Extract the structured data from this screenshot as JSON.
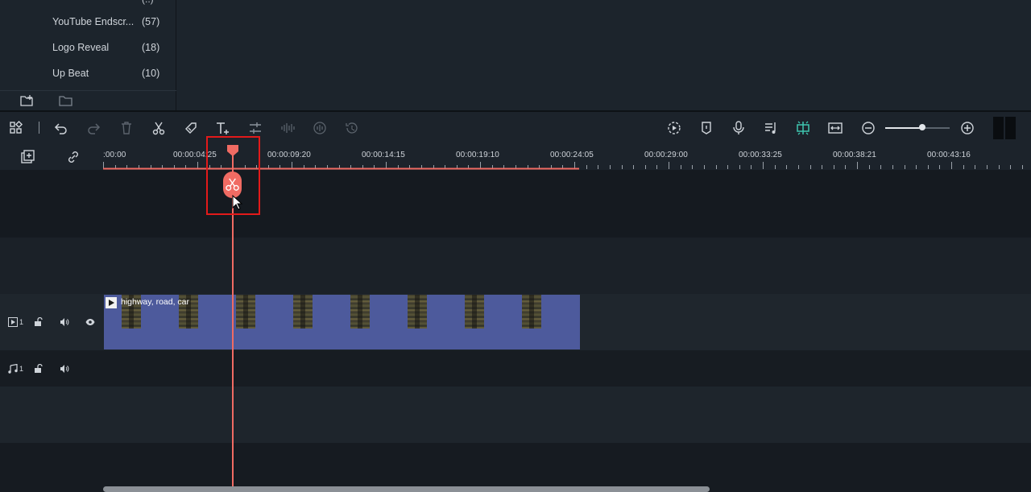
{
  "library": {
    "partial_count": "(..)",
    "items": [
      {
        "name": "YouTube Endscr...",
        "count": "(57)"
      },
      {
        "name": "Logo Reveal",
        "count": "(18)"
      },
      {
        "name": "Up Beat",
        "count": "(10)"
      }
    ]
  },
  "ruler": {
    "timecodes": [
      ":00:00",
      "00:00:04:25",
      "00:00:09:20",
      "00:00:14:15",
      "00:00:19:10",
      "00:00:24:05",
      "00:00:29:00",
      "00:00:33:25",
      "00:00:38:21",
      "00:00:43:16"
    ]
  },
  "tracks": {
    "video_number": "1",
    "audio_number": "1"
  },
  "clip": {
    "title": "highway, road, car"
  },
  "zoom": {
    "level": 0.58
  },
  "colors": {
    "playhead": "#f06b63",
    "highlight": "#e21a1a",
    "clip": "#4d5a9c",
    "active_icon": "#3ec6b0"
  }
}
